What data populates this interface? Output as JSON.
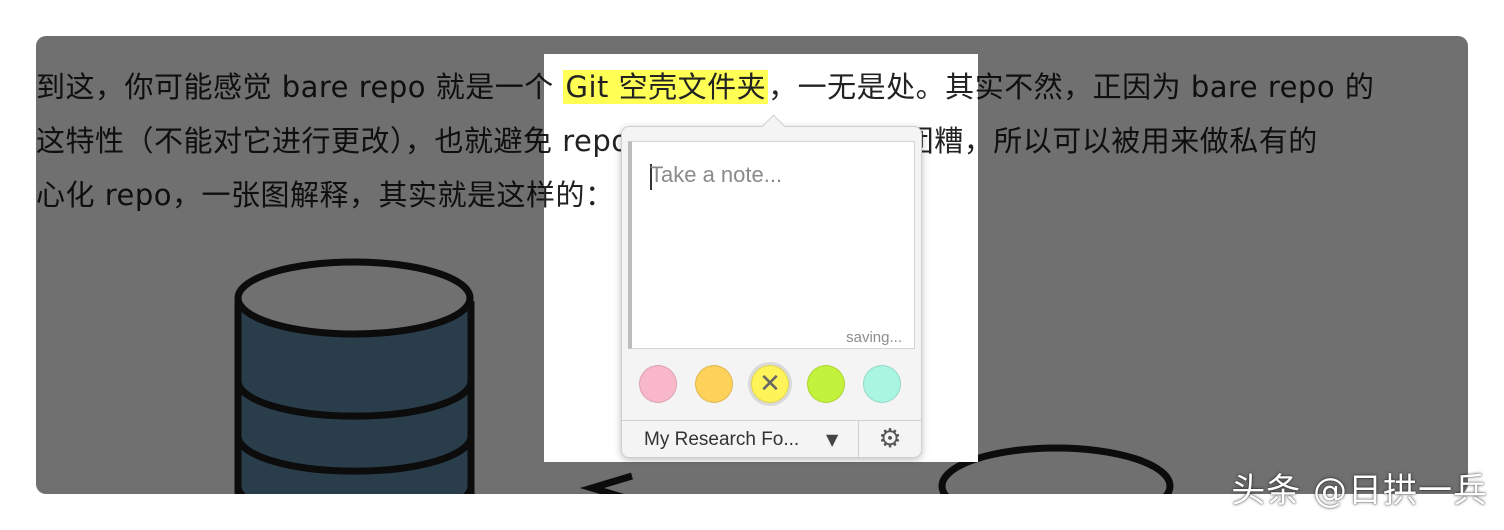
{
  "article": {
    "line1_pre": "到这，你可能感觉 bare repo 就是一个 ",
    "line1_highlight": "Git 空壳文件夹",
    "line1_post": "，一无是处。其实不然，正因为 bare repo 的",
    "line2": "这特性（不能对它进行更改），也就避免 repo 里面的内容被弄的一团糟，所以可以被用来做私有的",
    "line3": "心化 repo，一张图解释，其实就是这样的："
  },
  "note_popup": {
    "placeholder": "Take a note...",
    "status": "saving...",
    "colors": [
      {
        "name": "pink",
        "hex": "#f9b8c9"
      },
      {
        "name": "orange",
        "hex": "#fdd15a"
      },
      {
        "name": "yellow",
        "hex": "#fff35a",
        "selected": true,
        "mark": "✕"
      },
      {
        "name": "green",
        "hex": "#c3f23c"
      },
      {
        "name": "mint",
        "hex": "#a9f5e1"
      }
    ],
    "folder": "My Research Fo...",
    "folder_icon": "chevron-down-icon",
    "settings_icon": "gear-icon"
  },
  "colors": {
    "highlight": "#ffff55",
    "overlay": "rgba(0,0,0,0.56)",
    "db_fill": "#5e8ba8"
  },
  "watermark": "头条 @日拱一兵"
}
